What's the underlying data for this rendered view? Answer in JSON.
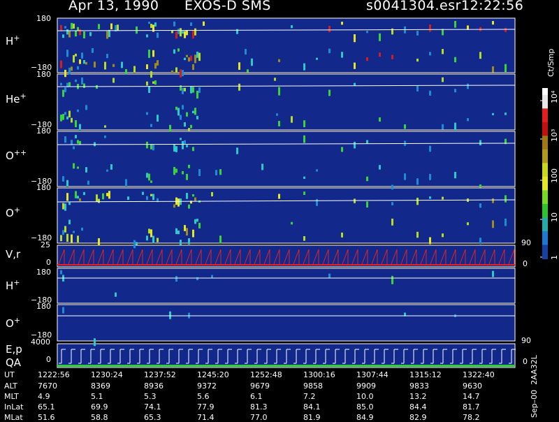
{
  "header": {
    "date": "Apr 13, 1990",
    "mission": "EXOS-D SMS",
    "file": "s0041304.esr",
    "time": "12:22:56"
  },
  "panels": [
    {
      "ion": "H",
      "charge": "+",
      "top": "180",
      "bottom": "−180"
    },
    {
      "ion": "He",
      "charge": "+",
      "top": "180",
      "bottom": "−180"
    },
    {
      "ion": "O",
      "charge": "++",
      "top": "180",
      "bottom": "−180"
    },
    {
      "ion": "O",
      "charge": "+",
      "top": "180",
      "bottom": "−180"
    },
    {
      "ion": "V,r",
      "charge": "",
      "top": "25",
      "bottom": "0",
      "right": "90",
      "right_bottom": "0"
    },
    {
      "ion": "H",
      "charge": "+",
      "top": "180",
      "bottom": "−180"
    },
    {
      "ion": "O",
      "charge": "+",
      "top": "180",
      "bottom": "−180",
      "right": "90"
    },
    {
      "ion": "E,p",
      "sub": "QA",
      "top": "4000",
      "bottom": "0",
      "right": "0"
    }
  ],
  "colorbar": {
    "unit": "Ct/Smp",
    "ticks": [
      "1",
      "10",
      "100",
      "10³",
      "10⁴"
    ]
  },
  "side_label": "Sep–00  2AA32L",
  "table": {
    "rows": [
      {
        "name": "UT",
        "values": [
          "1222:56",
          "1230:24",
          "1237:52",
          "1245:20",
          "1252:48",
          "1300:16",
          "1307:44",
          "1315:12",
          "1322:40"
        ]
      },
      {
        "name": "ALT",
        "values": [
          "7670",
          "8369",
          "8936",
          "9372",
          "9679",
          "9858",
          "9909",
          "9833",
          "9630"
        ]
      },
      {
        "name": "MLT",
        "values": [
          "4.9",
          "5.1",
          "5.3",
          "5.6",
          "6.1",
          "7.2",
          "10.0",
          "13.2",
          "14.7"
        ]
      },
      {
        "name": "InLat",
        "values": [
          "65.1",
          "69.9",
          "74.1",
          "77.9",
          "81.3",
          "84.1",
          "85.0",
          "84.4",
          "81.7"
        ]
      },
      {
        "name": "MLat",
        "values": [
          "51.6",
          "58.8",
          "65.3",
          "71.4",
          "77.0",
          "81.9",
          "84.9",
          "82.9",
          "78.2"
        ]
      }
    ]
  },
  "chart_data": {
    "type": "heatmap",
    "title": "Apr 13, 1990   EXOS-D SMS",
    "x_label": "UT",
    "x_ticks": [
      "1222:56",
      "1230:24",
      "1237:52",
      "1245:20",
      "1252:48",
      "1300:16",
      "1307:44",
      "1315:12",
      "1322:40"
    ],
    "y_range_pitch": [
      -180,
      180
    ],
    "colorbar_unit": "Ct/Smp",
    "colorbar_range": [
      1,
      10000
    ],
    "colorbar_scale": "log",
    "panels": [
      "H+",
      "He+",
      "O++",
      "O+",
      "V,r",
      "H+",
      "O+",
      "E,p / QA"
    ],
    "background_color": "#12288a",
    "color_scale": [
      "#12288a",
      "#1e8cd2",
      "#2ec8c8",
      "#3cd23c",
      "#b4dc28",
      "#e6e628",
      "#a08c1e",
      "#d21e1e",
      "#ffffff"
    ]
  }
}
